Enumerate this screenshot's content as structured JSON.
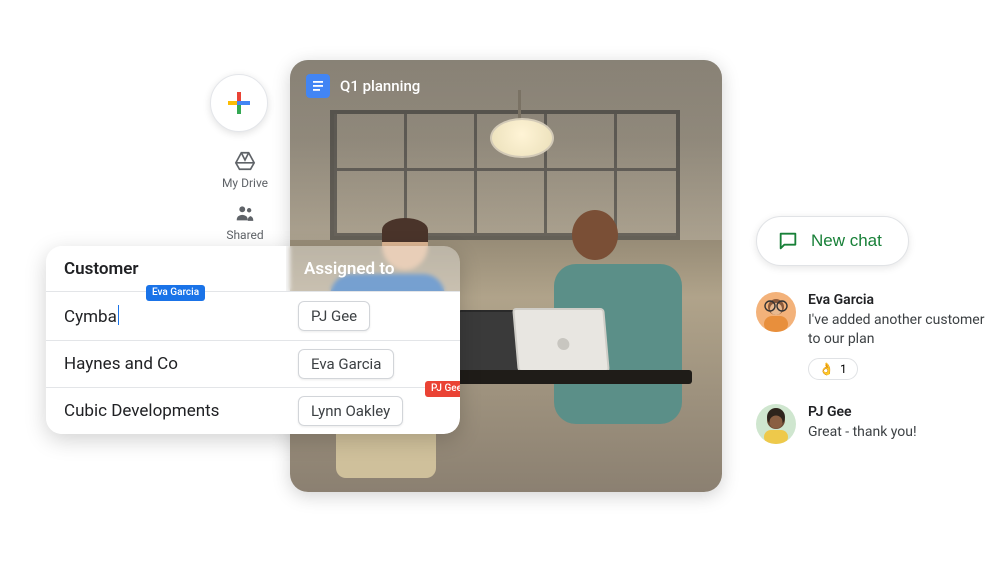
{
  "drive": {
    "new_button_aria": "Create new",
    "my_drive_label": "My Drive",
    "shared_label": "Shared"
  },
  "photo": {
    "doc_title": "Q1 planning"
  },
  "table": {
    "columns": {
      "customer": "Customer",
      "assigned": "Assigned to"
    },
    "rows": [
      {
        "customer": "Cymba",
        "assigned": "PJ Gee",
        "editing_flag": "Eva Garcia",
        "show_caret": true
      },
      {
        "customer": "Haynes and Co",
        "assigned": "Eva Garcia"
      },
      {
        "customer": "Cubic Developments",
        "assigned": "Lynn Oakley",
        "assigned_flag": "PJ Gee"
      }
    ]
  },
  "chat": {
    "new_chat_label": "New chat",
    "messages": [
      {
        "author": "Eva Garcia",
        "text": "I've added another customer to our plan",
        "reaction_emoji": "👌",
        "reaction_count": "1"
      },
      {
        "author": "PJ Gee",
        "text": "Great - thank you!"
      }
    ]
  }
}
